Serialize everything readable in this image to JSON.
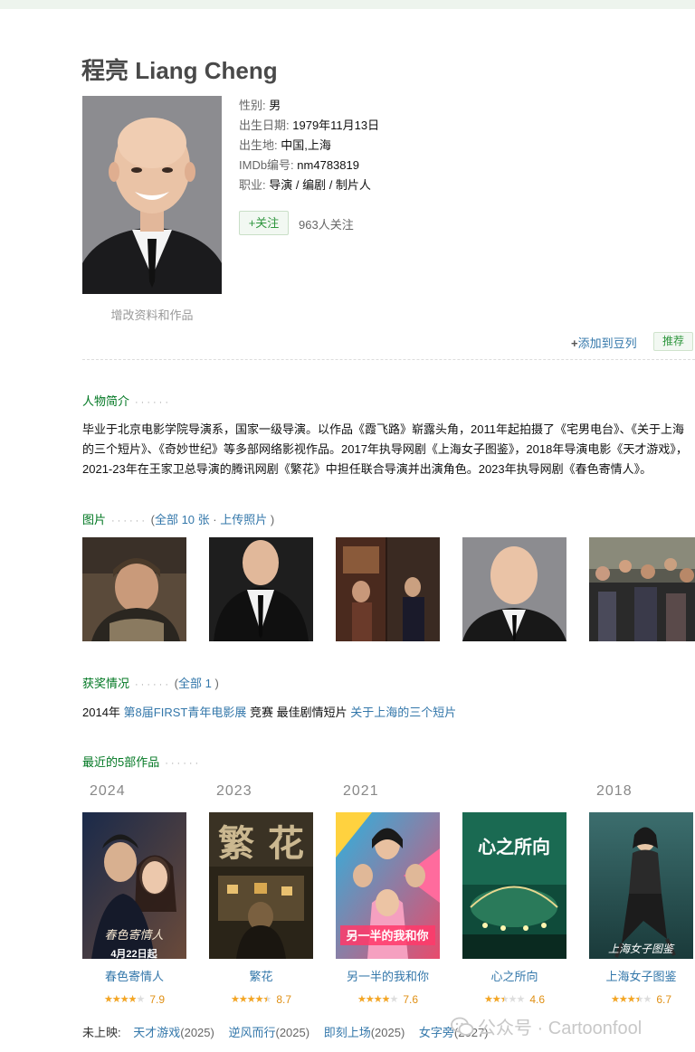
{
  "person": {
    "name": "程亮 Liang Cheng",
    "edit_link": "增改资料和作品",
    "info": [
      {
        "key": "性别:",
        "value": "男"
      },
      {
        "key": "出生日期:",
        "value": "1979年11月13日"
      },
      {
        "key": "出生地:",
        "value": "中国,上海"
      },
      {
        "key": "IMDb编号:",
        "value": "nm4783819"
      },
      {
        "key": "职业:",
        "value": "导演 / 编剧 / 制片人"
      }
    ],
    "follow_label": "+关注",
    "follow_count": "963人关注",
    "add_list_plus": "+",
    "add_list": "添加到豆列",
    "recommend": "推荐"
  },
  "bio": {
    "title": "人物简介",
    "dots": "······",
    "text": "毕业于北京电影学院导演系，国家一级导演。以作品《霞飞路》崭露头角，2011年起拍摄了《宅男电台》、《关于上海的三个短片》、《奇妙世纪》等多部网络影视作品。2017年执导网剧《上海女子图鉴》，2018年导演电影《天才游戏》，2021-23年在王家卫总导演的腾讯网剧《繁花》中担任联合导演并出演角色。2023年执导网剧《春色寄情人》。"
  },
  "photos": {
    "title": "图片",
    "dots": "······",
    "paren_open": "(",
    "all_link": "全部 10 张",
    "sep": "·",
    "upload_link": "上传照片",
    "paren_close": ")",
    "items": [
      "photo-1",
      "photo-2",
      "photo-3",
      "photo-4",
      "photo-5"
    ]
  },
  "awards": {
    "title": "获奖情况",
    "dots": "······",
    "paren_open": "(",
    "all_link": "全部 1",
    "paren_close": ")",
    "year": "2014年",
    "festival": "第8届FIRST青年电影展",
    "category": "竞赛 最佳剧情短片",
    "work": "关于上海的三个短片"
  },
  "works": {
    "title": "最近的5部作品",
    "dots": "······",
    "items": [
      {
        "year": "2024",
        "title": "春色寄情人",
        "rating": 7.9,
        "stars_fraction": 0.8,
        "poster_caption": "4月22日起",
        "poster_colors": [
          "#1a2a4a",
          "#6a4a3a"
        ]
      },
      {
        "year": "2023",
        "title": "繁花",
        "rating": 8.7,
        "stars_fraction": 0.9,
        "poster_caption": "繁花",
        "poster_colors": [
          "#2a2418",
          "#7a6a40"
        ]
      },
      {
        "year": "2021",
        "title": "另一半的我和你",
        "rating": 7.6,
        "stars_fraction": 0.8,
        "poster_caption": "另一半的我和你",
        "poster_colors": [
          "#e84b6c",
          "#2bb3e0"
        ]
      },
      {
        "year": "",
        "title": "心之所向",
        "rating": 4.6,
        "stars_fraction": 0.5,
        "poster_caption": "心之所向",
        "poster_colors": [
          "#0f4b3a",
          "#2a7a5a"
        ]
      },
      {
        "year": "2018",
        "title": "上海女子图鉴",
        "rating": 6.7,
        "stars_fraction": 0.7,
        "poster_caption": "上海女子图鉴",
        "poster_colors": [
          "#2c5a5a",
          "#1a3a3a"
        ]
      }
    ]
  },
  "upcoming": {
    "label": "未上映:",
    "items": [
      {
        "title": "天才游戏",
        "year": "(2025)"
      },
      {
        "title": "逆风而行",
        "year": "(2025)"
      },
      {
        "title": "即刻上场",
        "year": "(2025)"
      },
      {
        "title": "女字旁",
        "year": "(2027)"
      }
    ]
  },
  "watermark": "公众号 · Cartoonfool",
  "colors": {
    "link": "#3377aa",
    "section_green": "#007722",
    "star": "#f5a623"
  }
}
